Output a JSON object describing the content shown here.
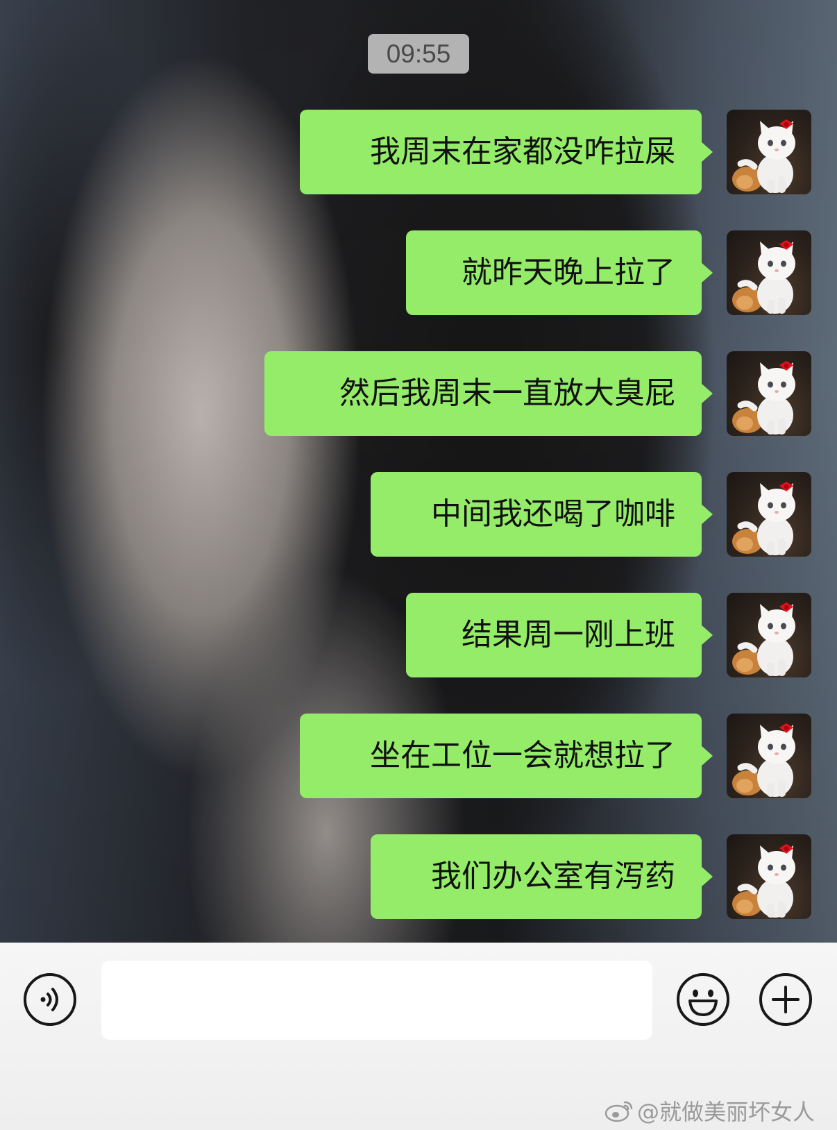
{
  "status": {
    "time": "09:55"
  },
  "messages": [
    {
      "text": "我周末在家都没咋拉屎",
      "side": "right"
    },
    {
      "text": "就昨天晚上拉了",
      "side": "right"
    },
    {
      "text": "然后我周末一直放大臭屁",
      "side": "right"
    },
    {
      "text": "中间我还喝了咖啡",
      "side": "right"
    },
    {
      "text": "结果周一刚上班",
      "side": "right"
    },
    {
      "text": "坐在工位一会就想拉了",
      "side": "right"
    },
    {
      "text": "我们办公室有泻药",
      "side": "right"
    }
  ],
  "avatar": {
    "icon": "cat-with-red-bow-avatar"
  },
  "input_bar": {
    "voice_icon": "voice-icon",
    "text_value": "",
    "emoji_icon": "emoji-icon",
    "plus_icon": "plus-icon"
  },
  "watermark": {
    "text": "@就做美丽坏女人",
    "icon": "weibo-icon"
  },
  "colors": {
    "bubble": "#95ec69",
    "input_bar_bg": "#f6f6f6"
  }
}
